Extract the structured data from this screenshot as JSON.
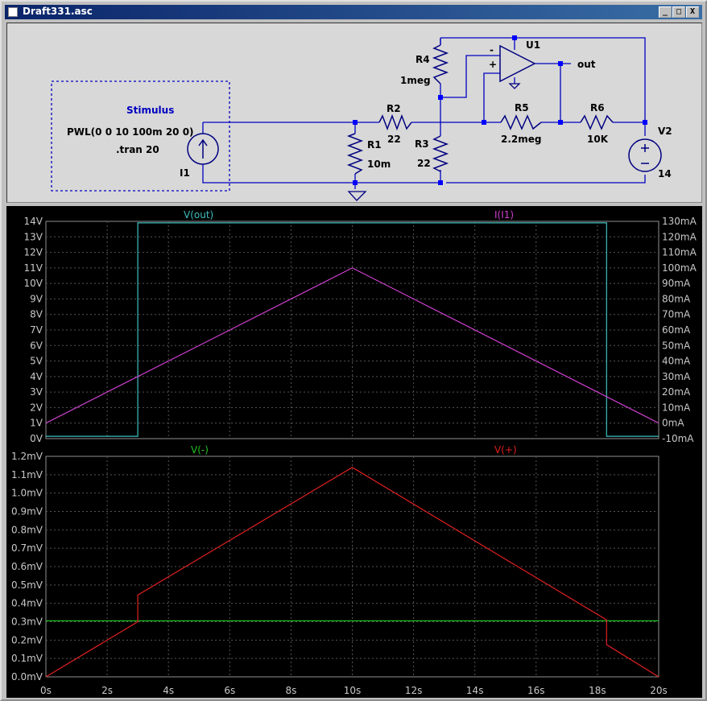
{
  "window": {
    "title": "Draft331.asc",
    "buttons": [
      "_",
      "□",
      "X"
    ]
  },
  "schematic": {
    "stimulus_title": "Stimulus",
    "stimulus_pwl": "PWL(0 0 10 100m 20 0)",
    "stimulus_tran": ".tran 20",
    "labels": {
      "I1": "I1",
      "R1": "R1",
      "R1_val": "10m",
      "R2": "R2",
      "R2_val": "22",
      "R3": "R3",
      "R3_val": "22",
      "R4": "R4",
      "R4_val": "1meg",
      "R5": "R5",
      "R5_val": "2.2meg",
      "R6": "R6",
      "R6_val": "10K",
      "U1": "U1",
      "out": "out",
      "V2": "V2",
      "V2_val": "14",
      "minus": "-",
      "plus": "+"
    },
    "colors": {
      "wire": "#0000c0",
      "component": "#000080",
      "node": "#0000ff",
      "text": "#000000",
      "stimulus_text": "#0000c0"
    }
  },
  "plots": {
    "colors": {
      "background": "#000000",
      "grid": "#555555",
      "axis_text": "#c8c8c8",
      "frame": "#909090"
    },
    "top": {
      "traces": [
        {
          "name": "V(out)",
          "color": "#3fbfbf"
        },
        {
          "name": "I(I1)",
          "color": "#d040d0"
        }
      ],
      "left_ticks": [
        "0V",
        "1V",
        "2V",
        "3V",
        "4V",
        "5V",
        "6V",
        "7V",
        "8V",
        "9V",
        "10V",
        "11V",
        "12V",
        "13V",
        "14V"
      ],
      "right_ticks": [
        "-10mA",
        "0mA",
        "10mA",
        "20mA",
        "30mA",
        "40mA",
        "50mA",
        "60mA",
        "70mA",
        "80mA",
        "90mA",
        "100mA",
        "110mA",
        "120mA",
        "130mA"
      ]
    },
    "bottom": {
      "traces": [
        {
          "name": "V(-)",
          "color": "#20c020"
        },
        {
          "name": "V(+)",
          "color": "#e02020"
        }
      ],
      "left_ticks": [
        "0.0mV",
        "0.1mV",
        "0.2mV",
        "0.3mV",
        "0.4mV",
        "0.5mV",
        "0.6mV",
        "0.7mV",
        "0.8mV",
        "0.9mV",
        "1.0mV",
        "1.1mV",
        "1.2mV"
      ]
    },
    "x_ticks": [
      "0s",
      "2s",
      "4s",
      "6s",
      "8s",
      "10s",
      "12s",
      "14s",
      "16s",
      "18s",
      "20s"
    ]
  },
  "chart_data": [
    {
      "type": "line",
      "xlim": [
        0,
        20
      ],
      "ylim": [
        0,
        14
      ],
      "y2lim": [
        -10,
        130
      ],
      "grid": true,
      "series": [
        {
          "name": "V(out)",
          "axis": "left",
          "unit": "V",
          "x": [
            0,
            3,
            3,
            18.3,
            18.3,
            20
          ],
          "y": [
            0.15,
            0.15,
            13.9,
            13.9,
            0.15,
            0.15
          ]
        },
        {
          "name": "I(I1)",
          "axis": "right",
          "unit": "mA",
          "x": [
            0,
            10,
            20
          ],
          "y": [
            0,
            100,
            0
          ]
        }
      ]
    },
    {
      "type": "line",
      "xlim": [
        0,
        20
      ],
      "ylim": [
        0,
        1.2
      ],
      "grid": true,
      "series": [
        {
          "name": "V(-)",
          "unit": "mV",
          "x": [
            0,
            20
          ],
          "y": [
            0.305,
            0.305
          ]
        },
        {
          "name": "V(+)",
          "unit": "mV",
          "x": [
            0,
            3,
            3,
            10,
            18.3,
            18.3,
            20
          ],
          "y": [
            0,
            0.3,
            0.445,
            1.14,
            0.31,
            0.175,
            0
          ]
        }
      ]
    }
  ]
}
